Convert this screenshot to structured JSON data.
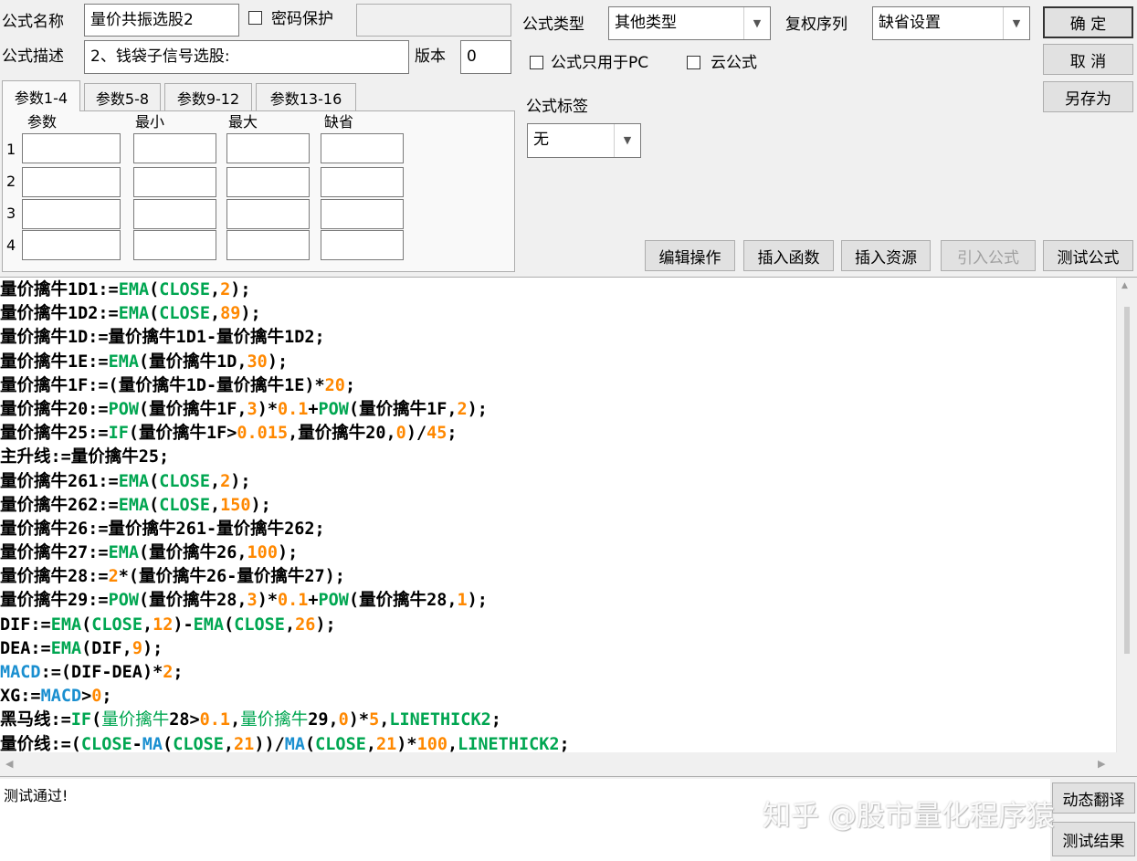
{
  "header": {
    "name_label": "公式名称",
    "name_value": "量价共振选股2",
    "password_label": "密码保护",
    "desc_label": "公式描述",
    "desc_value": "2、钱袋子信号选股:",
    "version_label": "版本",
    "version_value": "0",
    "type_label": "公式类型",
    "type_value": "其他类型",
    "fq_label": "复权序列",
    "fq_value": "缺省设置",
    "pc_only_label": "公式只用于PC",
    "cloud_label": "云公式",
    "tag_label": "公式标签",
    "tag_value": "无"
  },
  "buttons": {
    "ok": "确 定",
    "cancel": "取 消",
    "save_as": "另存为",
    "edit_ops": "编辑操作",
    "insert_func": "插入函数",
    "insert_res": "插入资源",
    "import_formula": "引入公式",
    "test_formula": "测试公式",
    "translate": "动态翻译",
    "test_result": "测试结果"
  },
  "tabs": [
    "参数1-4",
    "参数5-8",
    "参数9-12",
    "参数13-16"
  ],
  "params": {
    "headers": [
      "参数",
      "最小",
      "最大",
      "缺省"
    ],
    "rows": [
      "1",
      "2",
      "3",
      "4"
    ]
  },
  "code_lines": [
    [
      [
        "量价擒牛1D1:=",
        ""
      ],
      [
        "EMA",
        "fn"
      ],
      [
        "(",
        ""
      ],
      [
        "CLOSE",
        "fn"
      ],
      [
        ",",
        ""
      ],
      [
        "2",
        "num"
      ],
      [
        ");",
        ""
      ]
    ],
    [
      [
        "量价擒牛1D2:=",
        ""
      ],
      [
        "EMA",
        "fn"
      ],
      [
        "(",
        ""
      ],
      [
        "CLOSE",
        "fn"
      ],
      [
        ",",
        ""
      ],
      [
        "89",
        "num"
      ],
      [
        ");",
        ""
      ]
    ],
    [
      [
        "量价擒牛1D:=量价擒牛1D1-量价擒牛1D2;",
        ""
      ]
    ],
    [
      [
        "量价擒牛1E:=",
        ""
      ],
      [
        "EMA",
        "fn"
      ],
      [
        "(量价擒牛1D,",
        ""
      ],
      [
        "30",
        "num"
      ],
      [
        ");",
        ""
      ]
    ],
    [
      [
        "量价擒牛1F:=(量价擒牛1D-量价擒牛1E)*",
        ""
      ],
      [
        "20",
        "num"
      ],
      [
        ";",
        ""
      ]
    ],
    [
      [
        "量价擒牛20:=",
        ""
      ],
      [
        "POW",
        "fn"
      ],
      [
        "(量价擒牛1F,",
        ""
      ],
      [
        "3",
        "num"
      ],
      [
        ")*",
        ""
      ],
      [
        "0.1",
        "num"
      ],
      [
        "+",
        ""
      ],
      [
        "POW",
        "fn"
      ],
      [
        "(量价擒牛1F,",
        ""
      ],
      [
        "2",
        "num"
      ],
      [
        ");",
        ""
      ]
    ],
    [
      [
        "量价擒牛25:=",
        ""
      ],
      [
        "IF",
        "fn"
      ],
      [
        "(量价擒牛1F>",
        ""
      ],
      [
        "0.015",
        "num"
      ],
      [
        ",量价擒牛20,",
        ""
      ],
      [
        "0",
        "num"
      ],
      [
        ")/",
        ""
      ],
      [
        "45",
        "num"
      ],
      [
        ";",
        ""
      ]
    ],
    [
      [
        "主升线:=量价擒牛25;",
        ""
      ]
    ],
    [
      [
        "量价擒牛261:=",
        ""
      ],
      [
        "EMA",
        "fn"
      ],
      [
        "(",
        ""
      ],
      [
        "CLOSE",
        "fn"
      ],
      [
        ",",
        ""
      ],
      [
        "2",
        "num"
      ],
      [
        ");",
        ""
      ]
    ],
    [
      [
        "量价擒牛262:=",
        ""
      ],
      [
        "EMA",
        "fn"
      ],
      [
        "(",
        ""
      ],
      [
        "CLOSE",
        "fn"
      ],
      [
        ",",
        ""
      ],
      [
        "150",
        "num"
      ],
      [
        ");",
        ""
      ]
    ],
    [
      [
        "量价擒牛26:=量价擒牛261-量价擒牛262;",
        ""
      ]
    ],
    [
      [
        "量价擒牛27:=",
        ""
      ],
      [
        "EMA",
        "fn"
      ],
      [
        "(量价擒牛26,",
        ""
      ],
      [
        "100",
        "num"
      ],
      [
        ");",
        ""
      ]
    ],
    [
      [
        "量价擒牛28:=",
        ""
      ],
      [
        "2",
        "num"
      ],
      [
        "*(量价擒牛26-量价擒牛27);",
        ""
      ]
    ],
    [
      [
        "量价擒牛29:=",
        ""
      ],
      [
        "POW",
        "fn"
      ],
      [
        "(量价擒牛28,",
        ""
      ],
      [
        "3",
        "num"
      ],
      [
        ")*",
        ""
      ],
      [
        "0.1",
        "num"
      ],
      [
        "+",
        ""
      ],
      [
        "POW",
        "fn"
      ],
      [
        "(量价擒牛28,",
        ""
      ],
      [
        "1",
        "num"
      ],
      [
        ");",
        ""
      ]
    ],
    [
      [
        "DIF:=",
        ""
      ],
      [
        "EMA",
        "fn"
      ],
      [
        "(",
        ""
      ],
      [
        "CLOSE",
        "fn"
      ],
      [
        ",",
        ""
      ],
      [
        "12",
        "num"
      ],
      [
        ")-",
        ""
      ],
      [
        "EMA",
        "fn"
      ],
      [
        "(",
        ""
      ],
      [
        "CLOSE",
        "fn"
      ],
      [
        ",",
        ""
      ],
      [
        "26",
        "num"
      ],
      [
        ");",
        ""
      ]
    ],
    [
      [
        "DEA:=",
        ""
      ],
      [
        "EMA",
        "fn"
      ],
      [
        "(DIF,",
        ""
      ],
      [
        "9",
        "num"
      ],
      [
        ");",
        ""
      ]
    ],
    [
      [
        "MACD",
        "kw"
      ],
      [
        ":=(DIF-DEA)*",
        ""
      ],
      [
        "2",
        "num"
      ],
      [
        ";",
        ""
      ]
    ],
    [
      [
        "XG:=",
        ""
      ],
      [
        "MACD",
        "kw"
      ],
      [
        ">",
        ""
      ],
      [
        "0",
        "num"
      ],
      [
        ";",
        ""
      ]
    ],
    [
      [
        "黑马线:=",
        ""
      ],
      [
        "IF",
        "fn"
      ],
      [
        "(",
        ""
      ],
      [
        "量价擒牛",
        "green"
      ],
      [
        "28>",
        ""
      ],
      [
        "0.1",
        "num"
      ],
      [
        ",",
        ""
      ],
      [
        "量价擒牛",
        "green"
      ],
      [
        "29,",
        ""
      ],
      [
        "0",
        "num"
      ],
      [
        ")*",
        ""
      ],
      [
        "5",
        "num"
      ],
      [
        ",",
        ""
      ],
      [
        "LINETHICK2",
        "fn"
      ],
      [
        ";",
        ""
      ]
    ],
    [
      [
        "量价线:=(",
        ""
      ],
      [
        "CLOSE",
        "fn"
      ],
      [
        "-",
        ""
      ],
      [
        "MA",
        "kw"
      ],
      [
        "(",
        ""
      ],
      [
        "CLOSE",
        "fn"
      ],
      [
        ",",
        ""
      ],
      [
        "21",
        "num"
      ],
      [
        "))/",
        ""
      ],
      [
        "MA",
        "kw"
      ],
      [
        "(",
        ""
      ],
      [
        "CLOSE",
        "fn"
      ],
      [
        ",",
        ""
      ],
      [
        "21",
        "num"
      ],
      [
        ")*",
        ""
      ],
      [
        "100",
        "num"
      ],
      [
        ",",
        ""
      ],
      [
        "LINETHICK2",
        "fn"
      ],
      [
        ";",
        ""
      ]
    ]
  ],
  "status_text": "测试通过!",
  "watermark": "知乎 @股市量化程序猿"
}
